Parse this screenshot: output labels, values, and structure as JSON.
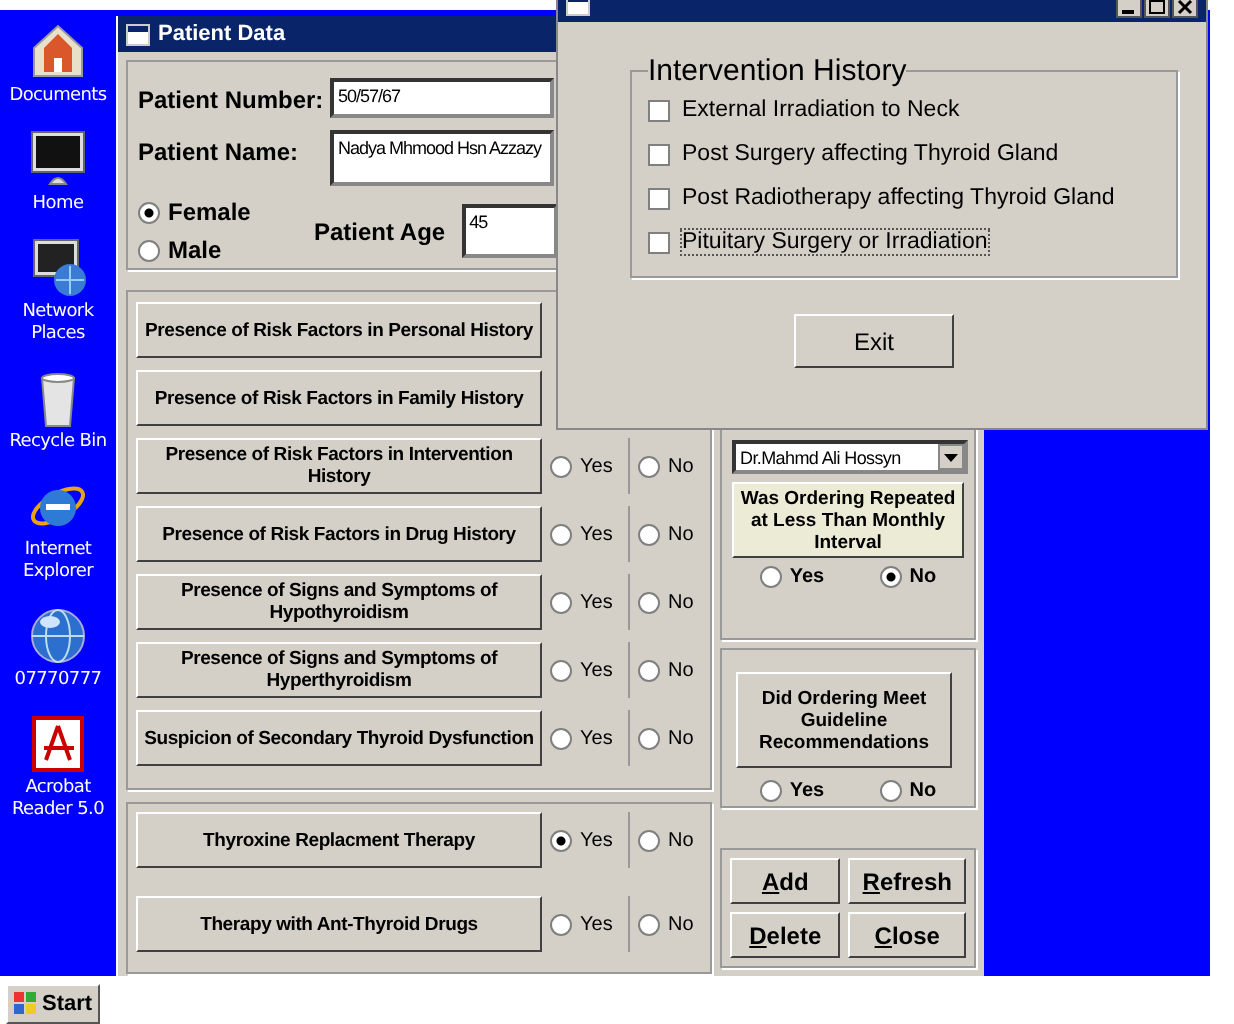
{
  "desktop_icons": [
    {
      "kind": "documents",
      "label": "Documents"
    },
    {
      "kind": "computer",
      "label": "Home"
    },
    {
      "kind": "network",
      "label": "Network Places"
    },
    {
      "kind": "recycle",
      "label": "Recycle Bin"
    },
    {
      "kind": "browser",
      "label": "Internet Explorer"
    },
    {
      "kind": "globe",
      "label": "07770777"
    },
    {
      "kind": "pdf",
      "label": "Acrobat Reader 5.0"
    }
  ],
  "start_button": "Start",
  "patient_window": {
    "title": "Patient Data",
    "patient_number_label": "Patient Number:",
    "patient_number": "50/57/67",
    "patient_name_label": "Patient Name:",
    "patient_name": "Nadya Mhmood Hsn Azzazy",
    "gender": [
      {
        "label": "Female",
        "selected": true
      },
      {
        "label": "Male",
        "selected": false
      }
    ],
    "age_label": "Patient Age",
    "age": "45",
    "questions": [
      {
        "label": "Presence of Risk Factors in Personal History"
      },
      {
        "label": "Presence of Risk Factors in Family History"
      },
      {
        "label": "Presence of Risk Factors in Intervention History",
        "options": [
          {
            "label": "Yes",
            "selected": false
          },
          {
            "label": "No",
            "selected": false
          }
        ]
      },
      {
        "label": "Presence of Risk Factors in Drug History",
        "options": [
          {
            "label": "Yes",
            "selected": false
          },
          {
            "label": "No",
            "selected": false
          }
        ]
      },
      {
        "label": "Presence of Signs and Symptoms of Hypothyroidism",
        "options": [
          {
            "label": "Yes",
            "selected": false
          },
          {
            "label": "No",
            "selected": false
          }
        ]
      },
      {
        "label": "Presence of Signs and Symptoms of Hyperthyroidism",
        "options": [
          {
            "label": "Yes",
            "selected": false
          },
          {
            "label": "No",
            "selected": false
          }
        ]
      },
      {
        "label": "Suspicion of Secondary Thyroid Dysfunction",
        "options": [
          {
            "label": "Yes",
            "selected": false
          },
          {
            "label": "No",
            "selected": false
          }
        ]
      }
    ],
    "therapies": [
      {
        "label": "Thyroxine Replacment Therapy",
        "options": [
          {
            "label": "Yes",
            "selected": true
          },
          {
            "label": "No",
            "selected": false
          }
        ]
      },
      {
        "label": "Therapy  with Ant-Thyroid Drugs",
        "options": [
          {
            "label": "Yes",
            "selected": false
          },
          {
            "label": "No",
            "selected": false
          }
        ]
      }
    ],
    "doctor": "Dr.Mahmd Ali Hossyn",
    "repeat_question": {
      "label": "Was Ordering Repeated at Less Than Monthly Interval",
      "options": [
        {
          "label": "Yes",
          "selected": false
        },
        {
          "label": "No",
          "selected": true
        }
      ]
    },
    "guideline_question": {
      "label": "Did Ordering Meet Guideline Recommendations",
      "options": [
        {
          "label": "Yes",
          "selected": false
        },
        {
          "label": "No",
          "selected": false
        }
      ]
    },
    "buttons": [
      "Add",
      "Refresh",
      "Delete",
      "Close"
    ]
  },
  "intervention_window": {
    "heading": "Intervention History",
    "items": [
      {
        "label": "External Irradiation to Neck",
        "checked": false,
        "focused": false
      },
      {
        "label": "Post Surgery affecting Thyroid Gland",
        "checked": false,
        "focused": false
      },
      {
        "label": "Post Radiotherapy affecting Thyroid Gland",
        "checked": false,
        "focused": false
      },
      {
        "label": "Pituitary Surgery or Irradiation",
        "checked": false,
        "focused": true
      }
    ],
    "exit_button": "Exit"
  }
}
